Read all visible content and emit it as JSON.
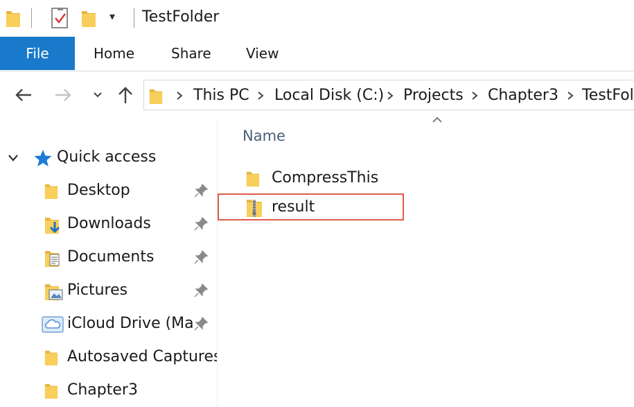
{
  "window": {
    "title": "TestFolder"
  },
  "qat": {
    "dropdown_glyph": "▾"
  },
  "ribbon": {
    "tabs": [
      {
        "label": "File",
        "active": true,
        "color": "#1979ca"
      },
      {
        "label": "Home"
      },
      {
        "label": "Share"
      },
      {
        "label": "View"
      }
    ]
  },
  "nav": {
    "back_icon": "back-arrow-icon",
    "forward_icon": "forward-arrow-icon",
    "recent_icon": "chevron-down-icon",
    "up_icon": "up-arrow-icon"
  },
  "breadcrumb": {
    "items": [
      "This PC",
      "Local Disk (C:)",
      "Projects",
      "Chapter3",
      "TestFol"
    ]
  },
  "sidebar": {
    "quick_access_label": "Quick access",
    "items": [
      {
        "label": "Desktop",
        "icon": "folder-icon",
        "pinned": true
      },
      {
        "label": "Downloads",
        "icon": "downloads-folder-icon",
        "pinned": true
      },
      {
        "label": "Documents",
        "icon": "documents-folder-icon",
        "pinned": true
      },
      {
        "label": "Pictures",
        "icon": "pictures-folder-icon",
        "pinned": true
      },
      {
        "label": "iCloud Drive (Ma",
        "icon": "icloud-drive-icon",
        "pinned": true
      },
      {
        "label": "Autosaved Captures",
        "icon": "folder-icon",
        "pinned": false
      },
      {
        "label": "Chapter3",
        "icon": "folder-icon",
        "pinned": false
      }
    ]
  },
  "content": {
    "column_header": "Name",
    "files": [
      {
        "name": "CompressThis",
        "icon": "folder-icon"
      },
      {
        "name": "result",
        "icon": "zip-folder-icon",
        "highlighted": true
      }
    ]
  },
  "colors": {
    "folder": "#f8cf5a",
    "folder_dark": "#e7b53e",
    "accent": "#1979ca",
    "highlight": "#e05a4a",
    "quick_access_star": "#1f7ad8"
  }
}
